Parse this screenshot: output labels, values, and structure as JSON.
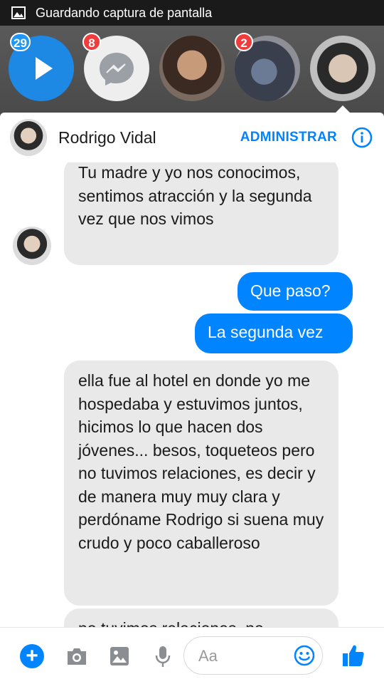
{
  "status_bar": {
    "icon": "screenshot-image-icon",
    "text": "Guardando captura de pantalla"
  },
  "chat_heads": [
    {
      "type": "video",
      "icon": "play-icon",
      "badge": "29",
      "badge_color": "#2196f3"
    },
    {
      "type": "messenger",
      "icon": "messenger-icon",
      "badge": "8",
      "badge_color": "#f03c3c"
    },
    {
      "type": "person",
      "badge": ""
    },
    {
      "type": "person",
      "badge": "2",
      "badge_color": "#f03c3c"
    },
    {
      "type": "person",
      "badge": "",
      "active": true
    }
  ],
  "header": {
    "name": "Rodrigo Vidal",
    "manage_label": "ADMINISTRAR",
    "info_icon": "info-icon"
  },
  "messages": [
    {
      "from": "them",
      "text": "Tu madre y yo nos conocimos, sentimos atracción y la segunda vez que nos vimos"
    },
    {
      "from": "me",
      "text": "Que paso?"
    },
    {
      "from": "me",
      "text": "La segunda vez"
    },
    {
      "from": "them",
      "text": "ella fue al hotel en donde yo me hospedaba y estuvimos juntos, hicimos lo que hacen dos jóvenes... besos, toqueteos pero no tuvimos relaciones, es decir y de manera muy muy clara y perdóname Rodrigo si suena muy crudo y poco caballeroso"
    },
    {
      "from": "them",
      "text": "no tuvimos relaciones, no"
    }
  ],
  "composer": {
    "placeholder": "Aa",
    "icons": [
      "plus-icon",
      "camera-icon",
      "gallery-icon",
      "microphone-icon",
      "emoji-icon",
      "thumbs-up-icon"
    ]
  },
  "colors": {
    "accent": "#0084ff",
    "incoming_bubble": "#e9e9ea",
    "badge_red": "#f03c3c",
    "badge_blue": "#2196f3"
  }
}
